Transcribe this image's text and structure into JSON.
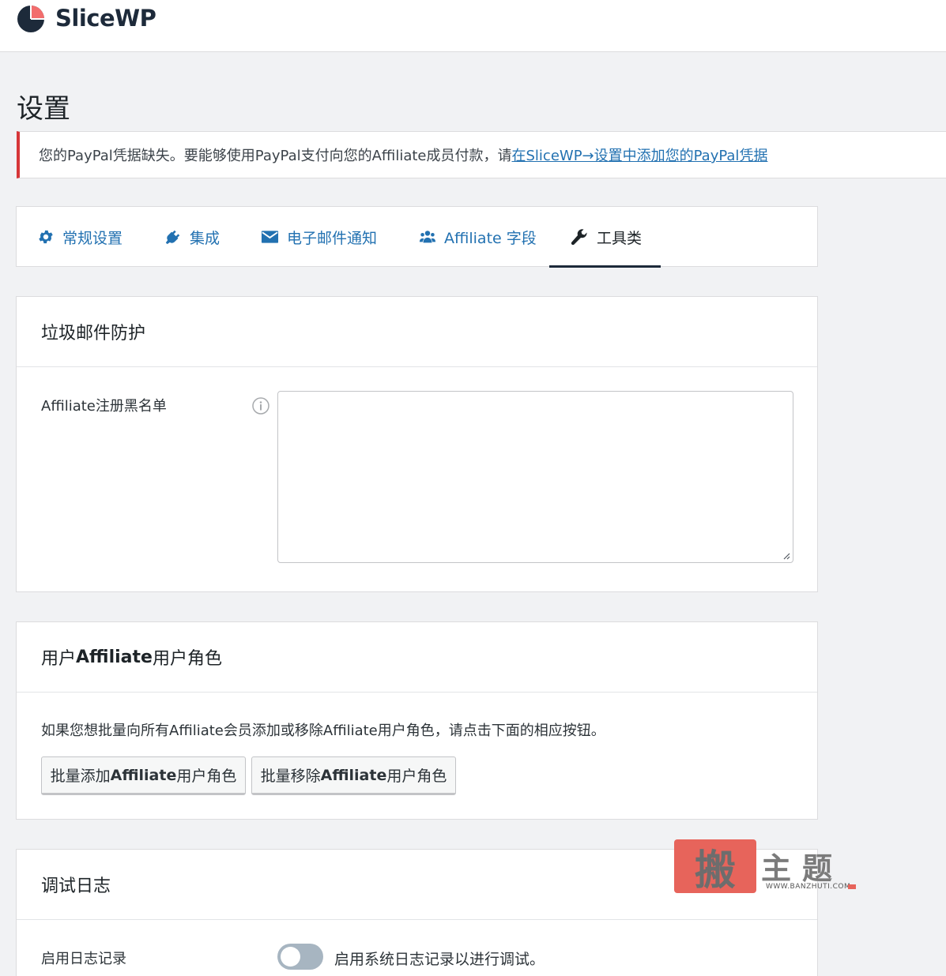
{
  "brand": {
    "name": "SliceWP"
  },
  "page": {
    "title": "设置"
  },
  "notice": {
    "text": "您的PayPal凭据缺失。要能够使用PayPal支付向您的Affiliate成员付款，请",
    "link": "在SliceWP→设置中添加您的PayPal凭据",
    "accent_color": "#d63638"
  },
  "tabs": [
    {
      "label": "常规设置",
      "icon": "gear-icon",
      "active": false
    },
    {
      "label": "集成",
      "icon": "plug-icon",
      "active": false
    },
    {
      "label": "电子邮件通知",
      "icon": "envelope-icon",
      "active": false
    },
    {
      "label": "Affiliate 字段",
      "icon": "users-icon",
      "active": false
    },
    {
      "label": "工具类",
      "icon": "wrench-icon",
      "active": true
    }
  ],
  "spam": {
    "heading": "垃圾邮件防护",
    "field_label": "Affiliate注册黑名单",
    "field_value": ""
  },
  "roles": {
    "heading_pre": "用户",
    "heading_bold": "Affiliate",
    "heading_post": "用户角色",
    "description": "如果您想批量向所有Affiliate会员添加或移除Affiliate用户角色，请点击下面的相应按钮。",
    "add_button": {
      "pre": "批量添加",
      "bold": "Affiliate",
      "post": "用户角色"
    },
    "remove_button": {
      "pre": "批量移除",
      "bold": "Affiliate",
      "post": "用户角色"
    }
  },
  "debug": {
    "heading": "调试日志",
    "field_label": "启用日志记录",
    "toggle_enabled": false,
    "toggle_text": "启用系统日志记录以进行调试。"
  },
  "watermark": {
    "seal_char": "搬",
    "chars": "主题",
    "url": "WWW.BANZHUTI.COM"
  },
  "colors": {
    "link": "#2271b1",
    "brand_dark": "#1d2a3a",
    "brand_accent": "#f26d6d",
    "toggle_off": "#a7b5c1"
  }
}
